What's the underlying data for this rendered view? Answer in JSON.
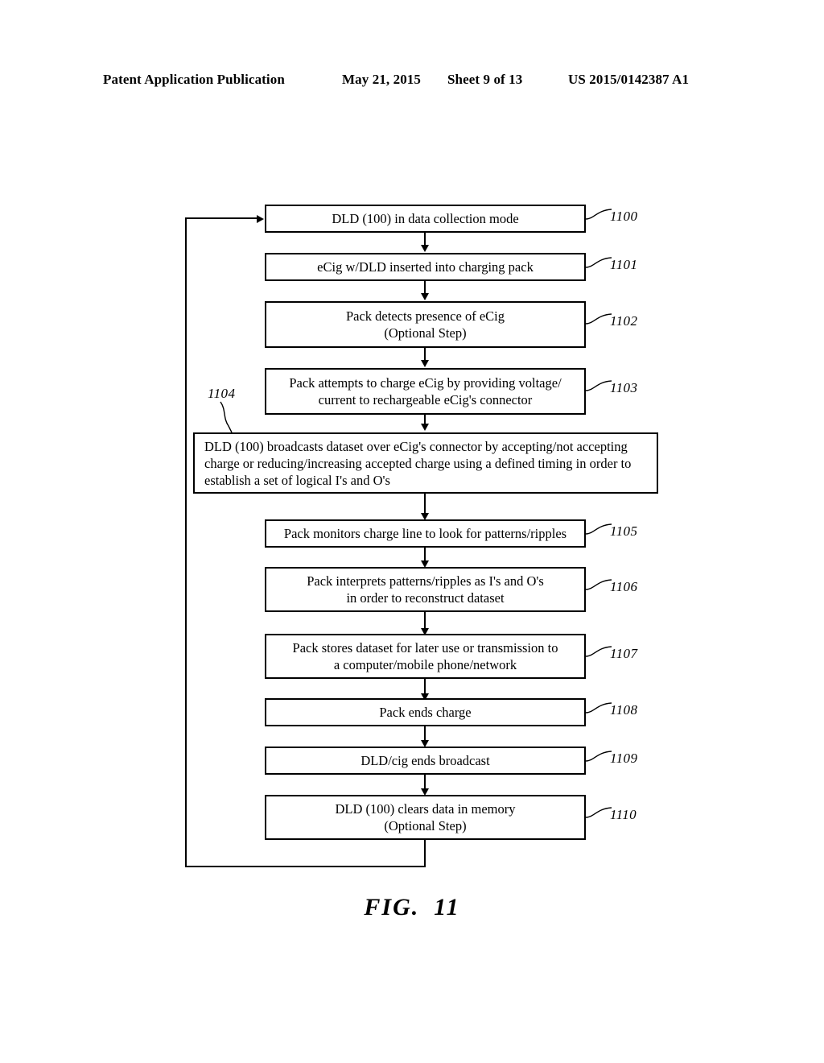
{
  "header": {
    "publication": "Patent Application Publication",
    "date": "May 21, 2015",
    "sheet": "Sheet 9 of 13",
    "doc_number": "US 2015/0142387 A1"
  },
  "figure": {
    "caption_label": "FIG.",
    "caption_number": "11",
    "steps": [
      {
        "ref": "1100",
        "text": "DLD (100) in data collection mode",
        "lines": 1
      },
      {
        "ref": "1101",
        "text": "eCig w/DLD inserted into charging pack",
        "lines": 1
      },
      {
        "ref": "1102",
        "text": "Pack detects presence of eCig\n(Optional Step)",
        "lines": 2
      },
      {
        "ref": "1103",
        "text": "Pack attempts to charge eCig by providing voltage/\ncurrent to rechargeable eCig's connector",
        "lines": 2
      },
      {
        "ref": "1104",
        "text": "DLD (100) broadcasts dataset over eCig's connector by accepting/not accepting charge or reducing/increasing accepted charge using a defined timing in order to establish a set of logical I's and O's",
        "lines": 3
      },
      {
        "ref": "1105",
        "text": "Pack monitors charge line to look for patterns/ripples",
        "lines": 1
      },
      {
        "ref": "1106",
        "text": "Pack interprets patterns/ripples as I's and O's\nin order to reconstruct dataset",
        "lines": 2
      },
      {
        "ref": "1107",
        "text": "Pack stores dataset for later use or transmission to\na computer/mobile phone/network",
        "lines": 2
      },
      {
        "ref": "1108",
        "text": "Pack ends charge",
        "lines": 1
      },
      {
        "ref": "1109",
        "text": "DLD/cig ends broadcast",
        "lines": 1
      },
      {
        "ref": "1110",
        "text": "DLD (100) clears data in memory\n(Optional Step)",
        "lines": 2
      }
    ]
  },
  "colors": {
    "ink": "#000000",
    "paper": "#ffffff"
  }
}
